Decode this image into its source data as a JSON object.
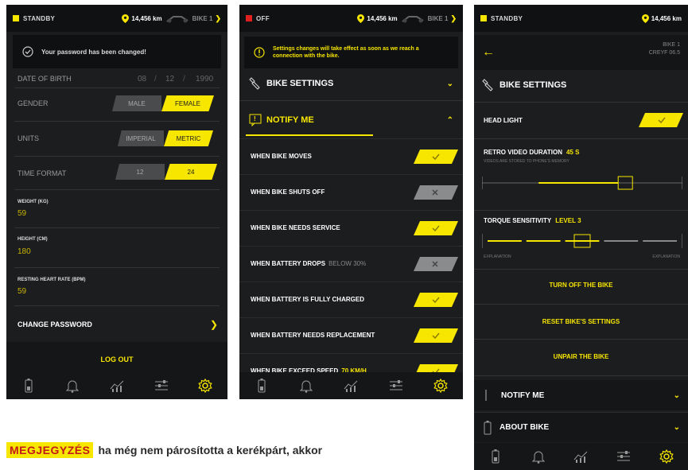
{
  "colors": {
    "accent": "#f7e600",
    "bg": "#1c1d1f",
    "status_red": "#e02020",
    "toggle_off": "#8a8b8d"
  },
  "screen1": {
    "status": {
      "label": "STANDBY",
      "odometer": "14,456 km",
      "bike": "BIKE 1"
    },
    "toast": "Your password has been changed!",
    "date_of_birth": {
      "label": "DATE OF BIRTH",
      "day": "08",
      "month": "12",
      "year": "1990"
    },
    "gender": {
      "label": "GENDER",
      "options": [
        "MALE",
        "FEMALE"
      ],
      "selected": "FEMALE"
    },
    "units": {
      "label": "UNITS",
      "options": [
        "IMPERIAL",
        "METRIC"
      ],
      "selected": "METRIC"
    },
    "time_format": {
      "label": "TIME FORMAT",
      "options": [
        "12",
        "24"
      ],
      "selected": "24"
    },
    "weight": {
      "label": "WEIGHT (KG)",
      "value": "59"
    },
    "height": {
      "label": "HEIGHT (CM)",
      "value": "180"
    },
    "resting_hr": {
      "label": "RESTING HEART RATE (BPM)",
      "value": "59"
    },
    "change_password": "CHANGE PASSWORD",
    "logout": "LOG OUT"
  },
  "screen2": {
    "status": {
      "label": "OFF",
      "odometer": "14,456 km",
      "bike": "BIKE 1"
    },
    "toast": "Settings changes will take effect as soon as we reach a connection with the bike.",
    "bike_settings": "BIKE SETTINGS",
    "notify_me": "NOTIFY ME",
    "rows": [
      {
        "label": "WHEN BIKE MOVES",
        "extra": "",
        "on": true
      },
      {
        "label": "WHEN BIKE SHUTS OFF",
        "extra": "",
        "on": false
      },
      {
        "label": "WHEN BIKE NEEDS SERVICE",
        "extra": "",
        "on": true
      },
      {
        "label": "WHEN BATTERY DROPS",
        "extra": "BELOW 30%",
        "on": false
      },
      {
        "label": "WHEN BATTERY IS FULLY CHARGED",
        "extra": "",
        "on": true
      },
      {
        "label": "WHEN BATTERY NEEDS REPLACEMENT",
        "extra": "",
        "on": true
      },
      {
        "label": "WHEN BIKE EXCEED SPEED",
        "extra": "70 KM/H",
        "on": true
      }
    ]
  },
  "screen3": {
    "status": {
      "label": "STANDBY",
      "odometer": "14,456 km"
    },
    "header": {
      "bike": "BIKE 1",
      "model": "CREYF 06.5"
    },
    "bike_settings": "BIKE SETTINGS",
    "head_light": {
      "label": "HEAD LIGHT",
      "on": true
    },
    "retro_video": {
      "label": "RETRO VIDEO DURATION",
      "value": "45 S",
      "hint": "VIDEOS ARE STORED TO PHONE'S MEMORY",
      "level": 0.6
    },
    "torque": {
      "label": "TORQUE SENSITIVITY",
      "value": "LEVEL 3",
      "left": "EXPLANATION",
      "right": "EXPLANATION",
      "level": 3,
      "max": 5
    },
    "turn_off": "TURN OFF THE BIKE",
    "reset": "RESET BIKE'S SETTINGS",
    "unpair": "UNPAIR THE BIKE",
    "notify_me": "NOTIFY ME",
    "about_bike": "ABOUT BIKE"
  },
  "note": {
    "tag": "MEGJEGYZÉS",
    "text": "ha még nem párosította a kerékpárt, akkor"
  }
}
